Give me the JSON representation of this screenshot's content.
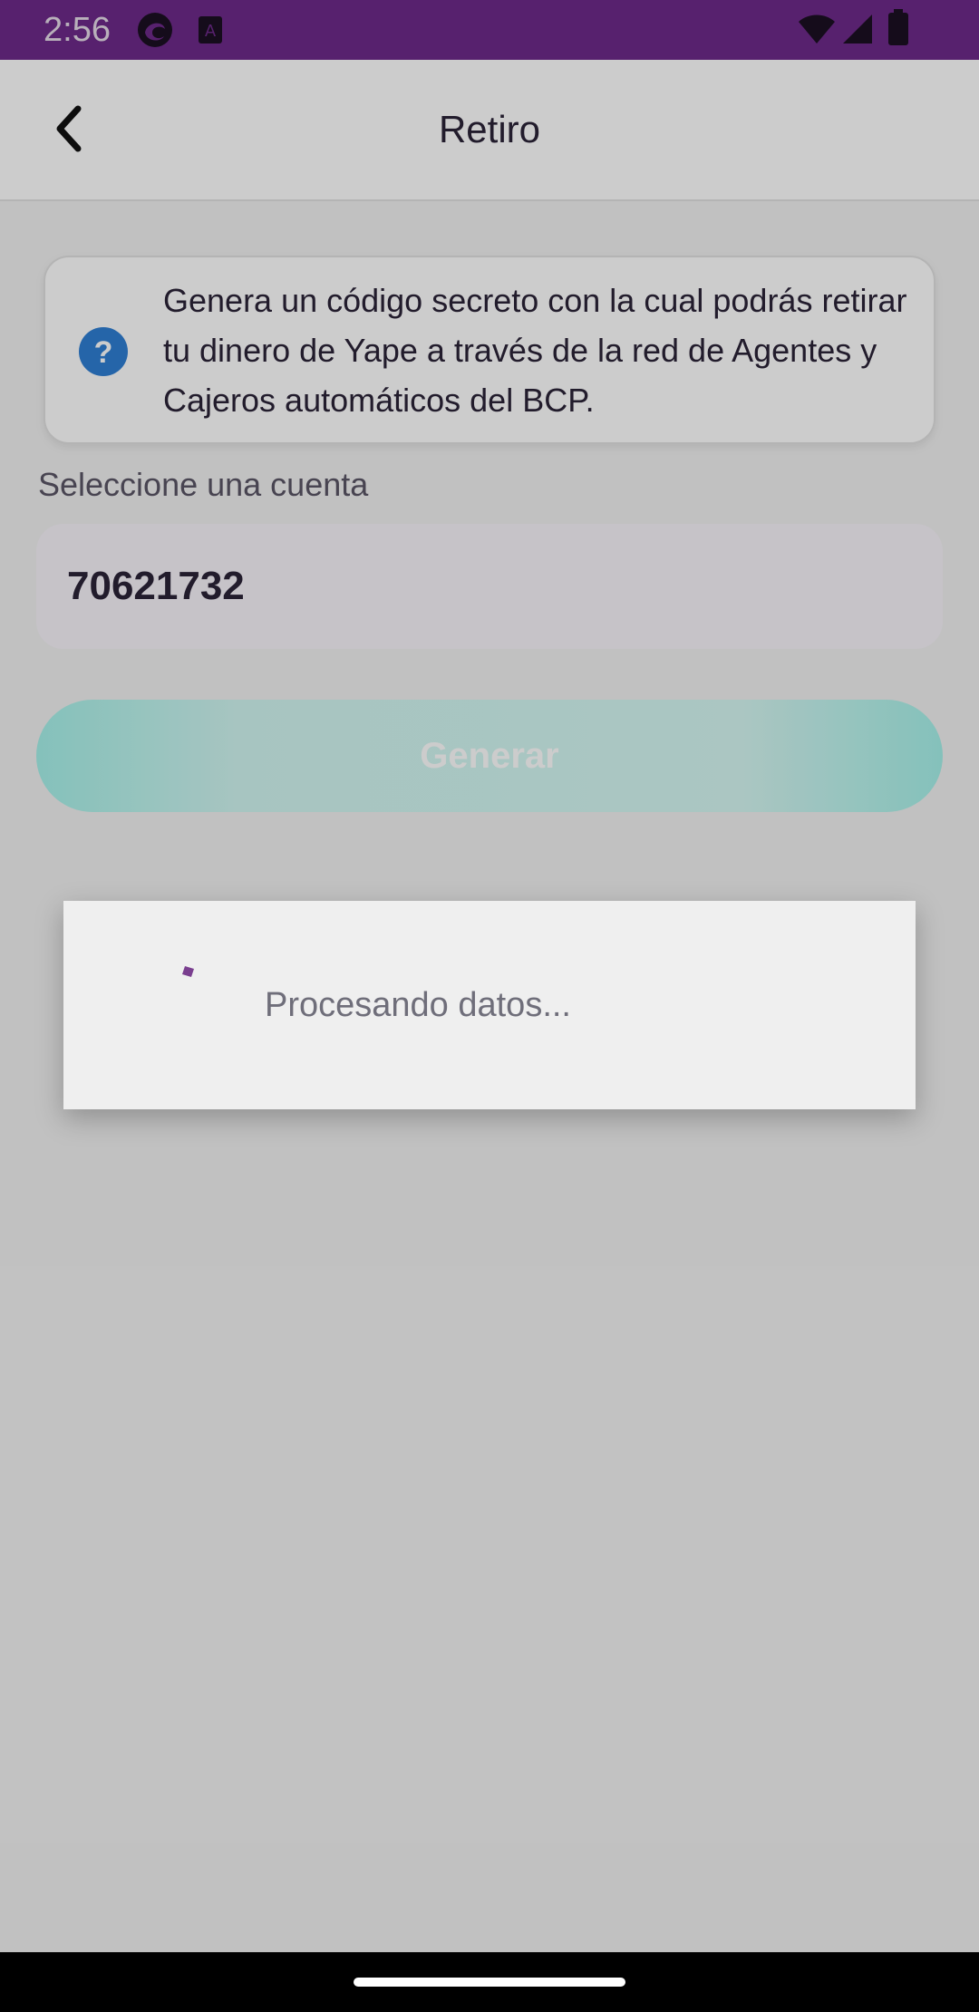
{
  "status_bar": {
    "time": "2:56",
    "icons": [
      "edge-icon",
      "app-a-icon",
      "wifi-icon",
      "signal-icon",
      "battery-icon"
    ]
  },
  "header": {
    "title": "Retiro",
    "back_icon": "chevron-left-icon"
  },
  "info_card": {
    "icon": "question-circle-icon",
    "text": "Genera un código secreto con la cual podrás retirar tu dinero de Yape a través de la red de Agentes y Cajeros automáticos del BCP."
  },
  "account": {
    "label": "Seleccione una cuenta",
    "value": "70621732"
  },
  "generate_button": {
    "label": "Generar",
    "enabled": false
  },
  "loading_dialog": {
    "text": "Procesando datos..."
  },
  "colors": {
    "brand_purple": "#6d2a8a",
    "accent_teal": "#a6f2ea",
    "help_blue": "#2f7fd4",
    "text_dark": "#2b2338"
  }
}
